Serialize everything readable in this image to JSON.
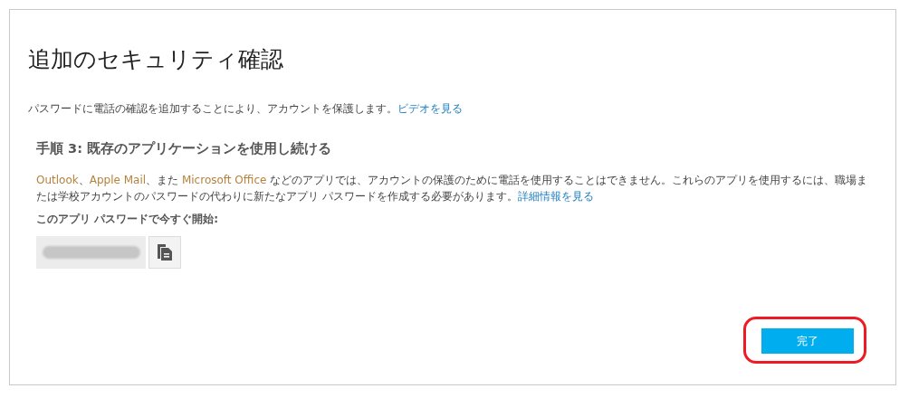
{
  "title": "追加のセキュリティ確認",
  "intro": {
    "text": "パスワードに電話の確認を追加することにより、アカウントを保護します。",
    "link": "ビデオを見る"
  },
  "step": {
    "heading": "手順 3: 既存のアプリケーションを使用し続ける",
    "body": [
      {
        "kind": "brand",
        "text": "Outlook"
      },
      {
        "kind": "plain",
        "text": "、"
      },
      {
        "kind": "brand",
        "text": "Apple Mail"
      },
      {
        "kind": "plain",
        "text": "、また "
      },
      {
        "kind": "brand",
        "text": "Microsoft Office"
      },
      {
        "kind": "plain",
        "text": " などのアプリでは、アカウントの保護のために電話を使用することはできません。これらのアプリを使用するには、職場または学校アカウントのパスワードの代わりに新たなアプリ パスワードを作成する必要があります。"
      },
      {
        "kind": "link",
        "text": "詳細情報を見る"
      }
    ],
    "password_label": "このアプリ パスワードで今すぐ開始:"
  },
  "buttons": [
    {
      "label": "完了",
      "highlighted": true
    }
  ]
}
